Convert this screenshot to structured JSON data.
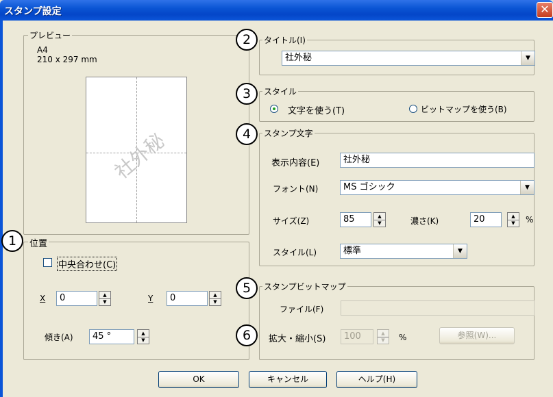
{
  "window": {
    "title": "スタンプ設定",
    "close_glyph": "✕"
  },
  "badges": [
    "1",
    "2",
    "3",
    "4",
    "5",
    "6"
  ],
  "preview": {
    "label": "プレビュー",
    "paper": "A4",
    "dimensions": "210 x 297 mm",
    "watermark": "社外秘"
  },
  "position": {
    "label": "位置",
    "center_label": "中央合わせ(C)",
    "center_checked": false,
    "x_label": "X",
    "x_value": "0",
    "y_label": "Y",
    "y_value": "0",
    "tilt_label": "傾き(A)",
    "tilt_value": "45 °"
  },
  "title_group": {
    "label": "タイトル(I)",
    "value": "社外秘"
  },
  "style_group": {
    "label": "スタイル",
    "options": [
      "文字を使う(T)",
      "ビットマップを使う(B)"
    ],
    "selected": "文字を使う(T)"
  },
  "stamp_text": {
    "label": "スタンプ文字",
    "content_label": "表示内容(E)",
    "content_value": "社外秘",
    "font_label": "フォント(N)",
    "font_value": "MS ゴシック",
    "size_label": "サイズ(Z)",
    "size_value": "85",
    "density_label": "濃さ(K)",
    "density_value": "20",
    "percent": "%",
    "style_label": "スタイル(L)",
    "style_value": "標準"
  },
  "stamp_bitmap": {
    "label": "スタンプビットマップ",
    "file_label": "ファイル(F)",
    "file_value": "",
    "scale_label": "拡大・縮小(S)",
    "scale_value": "100",
    "percent": "%",
    "browse_label": "参照(W)..."
  },
  "footer": {
    "ok": "OK",
    "cancel": "キャンセル",
    "help": "ヘルプ(H)"
  }
}
